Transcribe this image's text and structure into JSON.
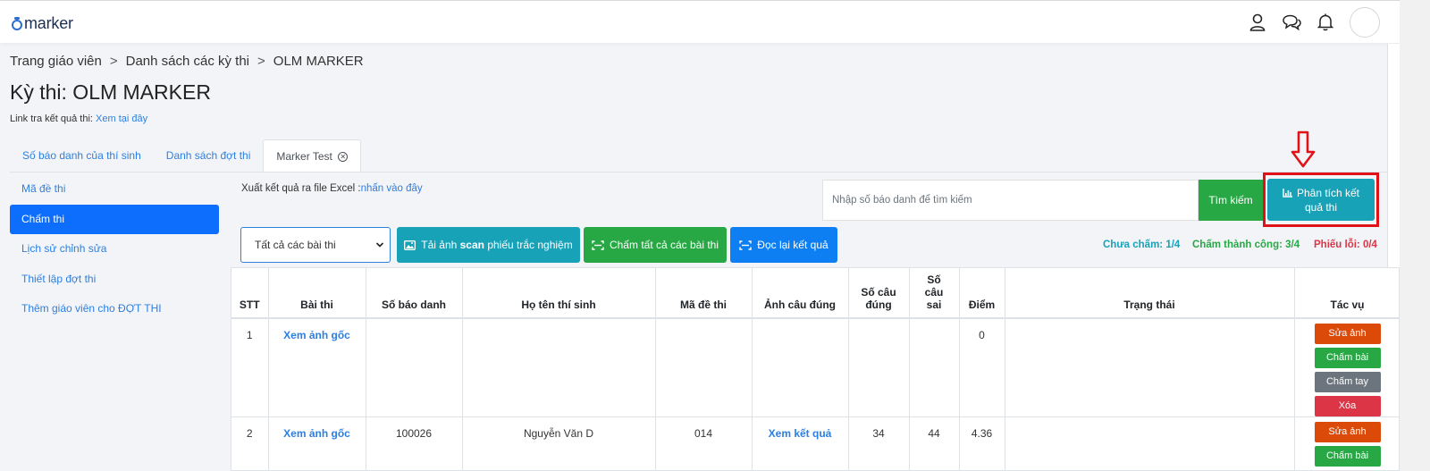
{
  "app": {
    "logo": "marker"
  },
  "breadcrumb": {
    "items": [
      "Trang giáo viên",
      "Danh sách các kỳ thi",
      "OLM MARKER"
    ],
    "separator": ">"
  },
  "page": {
    "title": "Kỳ thi: OLM MARKER",
    "result_link_label": "Link tra kết quả thi:",
    "result_link_text": "Xem tại đây"
  },
  "tabs": [
    {
      "label": "Số báo danh của thí sinh"
    },
    {
      "label": "Danh sách đợt thi"
    },
    {
      "label": "Marker Test",
      "active": true
    }
  ],
  "sidenav": [
    {
      "label": "Mã đề thi"
    },
    {
      "label": "Chấm thi",
      "active": true
    },
    {
      "label": "Lịch sử chỉnh sửa"
    },
    {
      "label": "Thiết lập đợt thi"
    },
    {
      "label": "Thêm giáo viên cho ĐỢT THI"
    }
  ],
  "excel": {
    "label": "Xuất kết quả ra file Excel :",
    "link": "nhấn vào đây"
  },
  "search": {
    "placeholder": "Nhập số báo danh để tìm kiếm",
    "button": "Tìm kiếm"
  },
  "analyze_button": "Phân tích kết quả thi",
  "filter": {
    "selected": "Tất cả các bài thi"
  },
  "actions": {
    "upload_prefix": "Tải ảnh ",
    "upload_bold": "scan",
    "upload_suffix": " phiếu trắc nghiệm",
    "grade_all": "Chấm tất cả các bài thi",
    "reread": "Đọc lại kết quả"
  },
  "stats": {
    "pending": "Chưa chấm: 1/4",
    "success": "Chấm thành công: 3/4",
    "error": "Phiếu lỗi: 0/4"
  },
  "table": {
    "headers": {
      "stt": "STT",
      "exam": "Bài thi",
      "sbd": "Số báo danh",
      "name": "Họ tên thí sinh",
      "code": "Mã đề thi",
      "image": "Ảnh câu đúng",
      "correct_1": "Số câu",
      "correct_2": "đúng",
      "wrong_1": "Số",
      "wrong_2": "câu",
      "wrong_3": "sai",
      "score": "Điểm",
      "status": "Trạng thái",
      "ops": "Tác vụ"
    },
    "rows": [
      {
        "stt": "1",
        "exam": "Xem ảnh gốc",
        "sbd": "",
        "name": "",
        "code": "",
        "image": "",
        "correct": "",
        "wrong": "",
        "score": "0",
        "status": "",
        "ops": [
          "Sửa ảnh",
          "Chấm bài",
          "Chấm tay",
          "Xóa"
        ]
      },
      {
        "stt": "2",
        "exam": "Xem ảnh gốc",
        "sbd": "100026",
        "name": "Nguyễn Văn D",
        "code": "014",
        "image": "Xem kết quả",
        "correct": "34",
        "wrong": "44",
        "score": "4.36",
        "status": "",
        "ops": [
          "Sửa ảnh",
          "Chấm bài"
        ]
      }
    ]
  },
  "colors": {
    "primary": "#0d6efd",
    "info": "#17a2b8",
    "success": "#28a745",
    "danger": "#dc3545",
    "highlight": "#e01218"
  },
  "icons": [
    "user-icon",
    "chat-icon",
    "bell-icon",
    "chart-icon",
    "image-icon",
    "scan-icon",
    "arrow-down-icon",
    "close-circle-icon"
  ]
}
